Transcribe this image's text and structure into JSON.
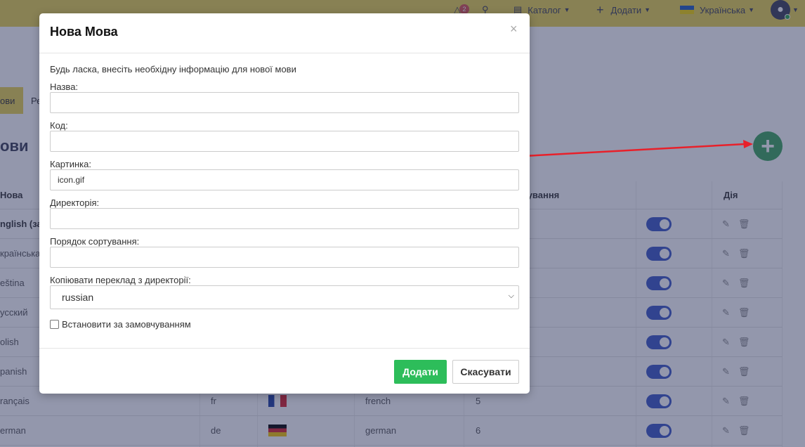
{
  "topbar": {
    "notification_count": "2",
    "catalog": "Каталог",
    "add": "Додати",
    "language": "Українська"
  },
  "background": {
    "tab_active": "ови",
    "tab_other": "Ре",
    "page_title": "ови",
    "table": {
      "headers": {
        "language": "Нова",
        "sort": "тування",
        "action": "Дія"
      },
      "rows": [
        {
          "name": "nglish (за",
          "code": "",
          "dir": "",
          "sort": ""
        },
        {
          "name": "країнська",
          "code": "",
          "dir": "",
          "sort": ""
        },
        {
          "name": "eština",
          "code": "",
          "dir": "",
          "sort": ""
        },
        {
          "name": "усский",
          "code": "",
          "dir": "",
          "sort": ""
        },
        {
          "name": "olish",
          "code": "",
          "dir": "",
          "sort": ""
        },
        {
          "name": "panish",
          "code": "",
          "dir": "",
          "sort": ""
        },
        {
          "name": "rançais",
          "code": "fr",
          "dir": "french",
          "sort": "5"
        },
        {
          "name": "erman",
          "code": "de",
          "dir": "german",
          "sort": "6"
        }
      ]
    }
  },
  "modal": {
    "title": "Нова Мова",
    "close": "×",
    "intro": "Будь ласка, внесіть необхідну інформацію для нової мови",
    "fields": {
      "name_label": "Назва:",
      "name_value": "",
      "code_label": "Код:",
      "code_value": "",
      "image_label": "Картинка:",
      "image_value": "icon.gif",
      "directory_label": "Директорія:",
      "directory_value": "",
      "sort_label": "Порядок сортування:",
      "sort_value": "",
      "copy_label": "Копіювати переклад з директорії:",
      "copy_selected": "russian",
      "default_label": "Встановити за замовчуванням"
    },
    "buttons": {
      "add": "Додати",
      "cancel": "Скасувати"
    }
  },
  "colors": {
    "accent_yellow": "#e9d24e",
    "success": "#2dbd5a",
    "toggle": "#3a56c4",
    "arrow": "#e8202a"
  }
}
